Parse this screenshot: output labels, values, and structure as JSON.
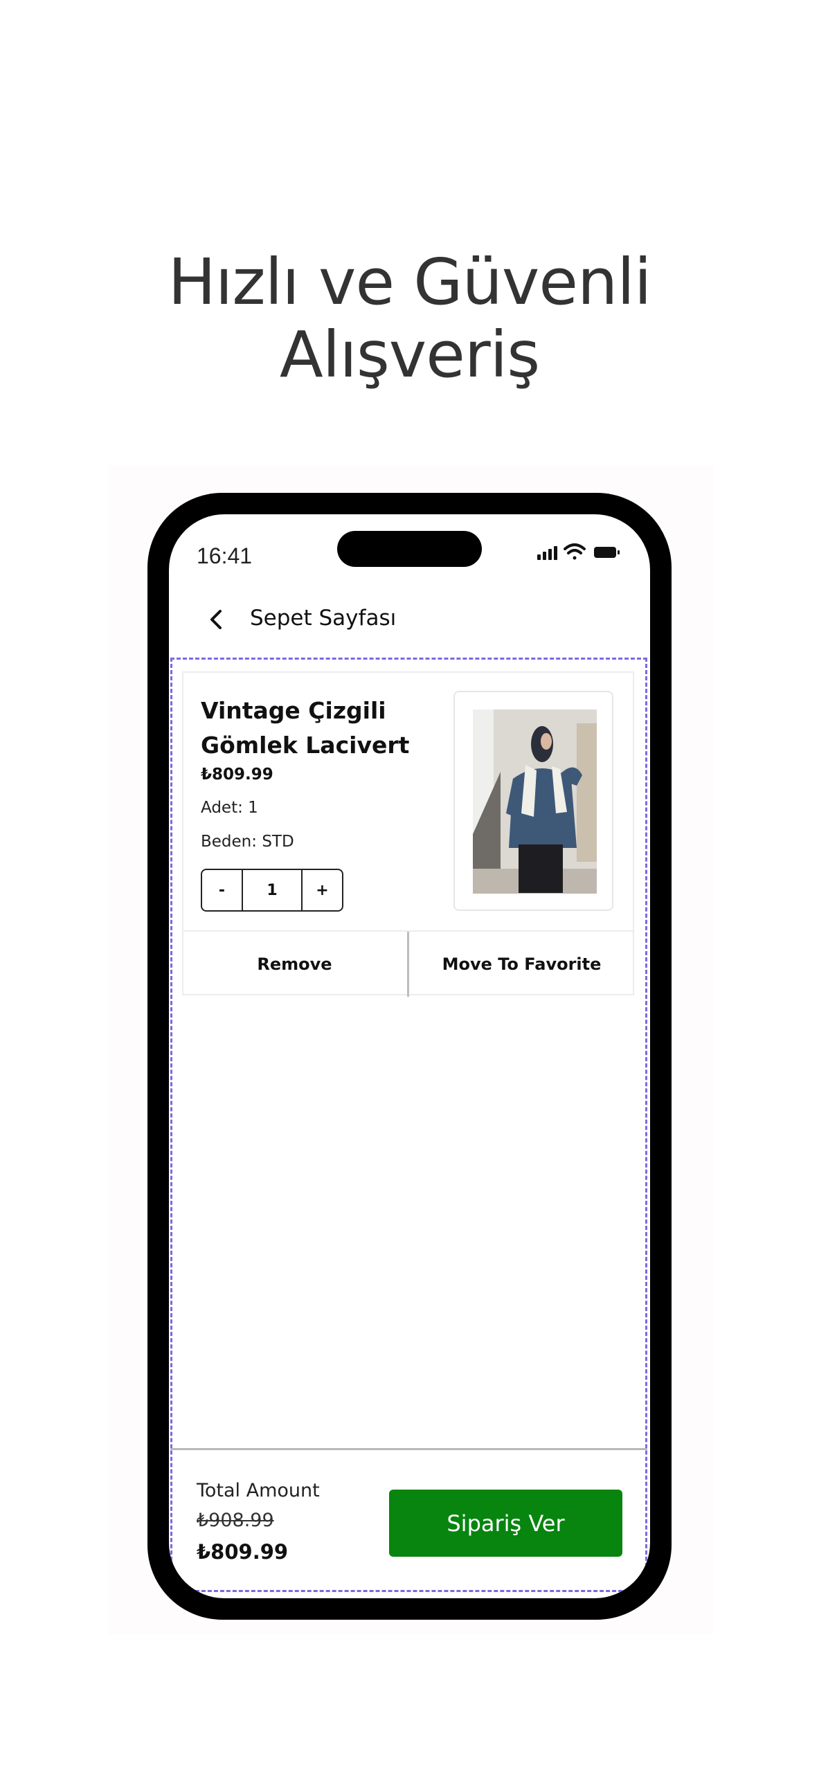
{
  "headline": {
    "line1": "Hızlı ve Güvenli",
    "line2": "Alışveriş"
  },
  "status_bar": {
    "time": "16:41",
    "icons": [
      "signal-icon",
      "wifi-icon",
      "battery-icon"
    ]
  },
  "nav": {
    "back_icon": "chevron-left-icon",
    "title": "Sepet Sayfası"
  },
  "cart_item": {
    "name": "Vintage Çizgili Gömlek Lacivert",
    "price": "₺809.99",
    "quantity_text": "Adet: 1",
    "size_text": "Beden: STD",
    "stepper": {
      "minus": "-",
      "value": "1",
      "plus": "+"
    },
    "remove_label": "Remove",
    "favorite_label": "Move To Favorite"
  },
  "summary": {
    "total_label": "Total Amount",
    "original_total": "₺908.99",
    "final_total": "₺809.99",
    "order_button": "Sipariş Ver"
  },
  "colors": {
    "accent_green": "#07850f",
    "dashed_border": "#7a6ae0",
    "headline_text": "#333333"
  }
}
